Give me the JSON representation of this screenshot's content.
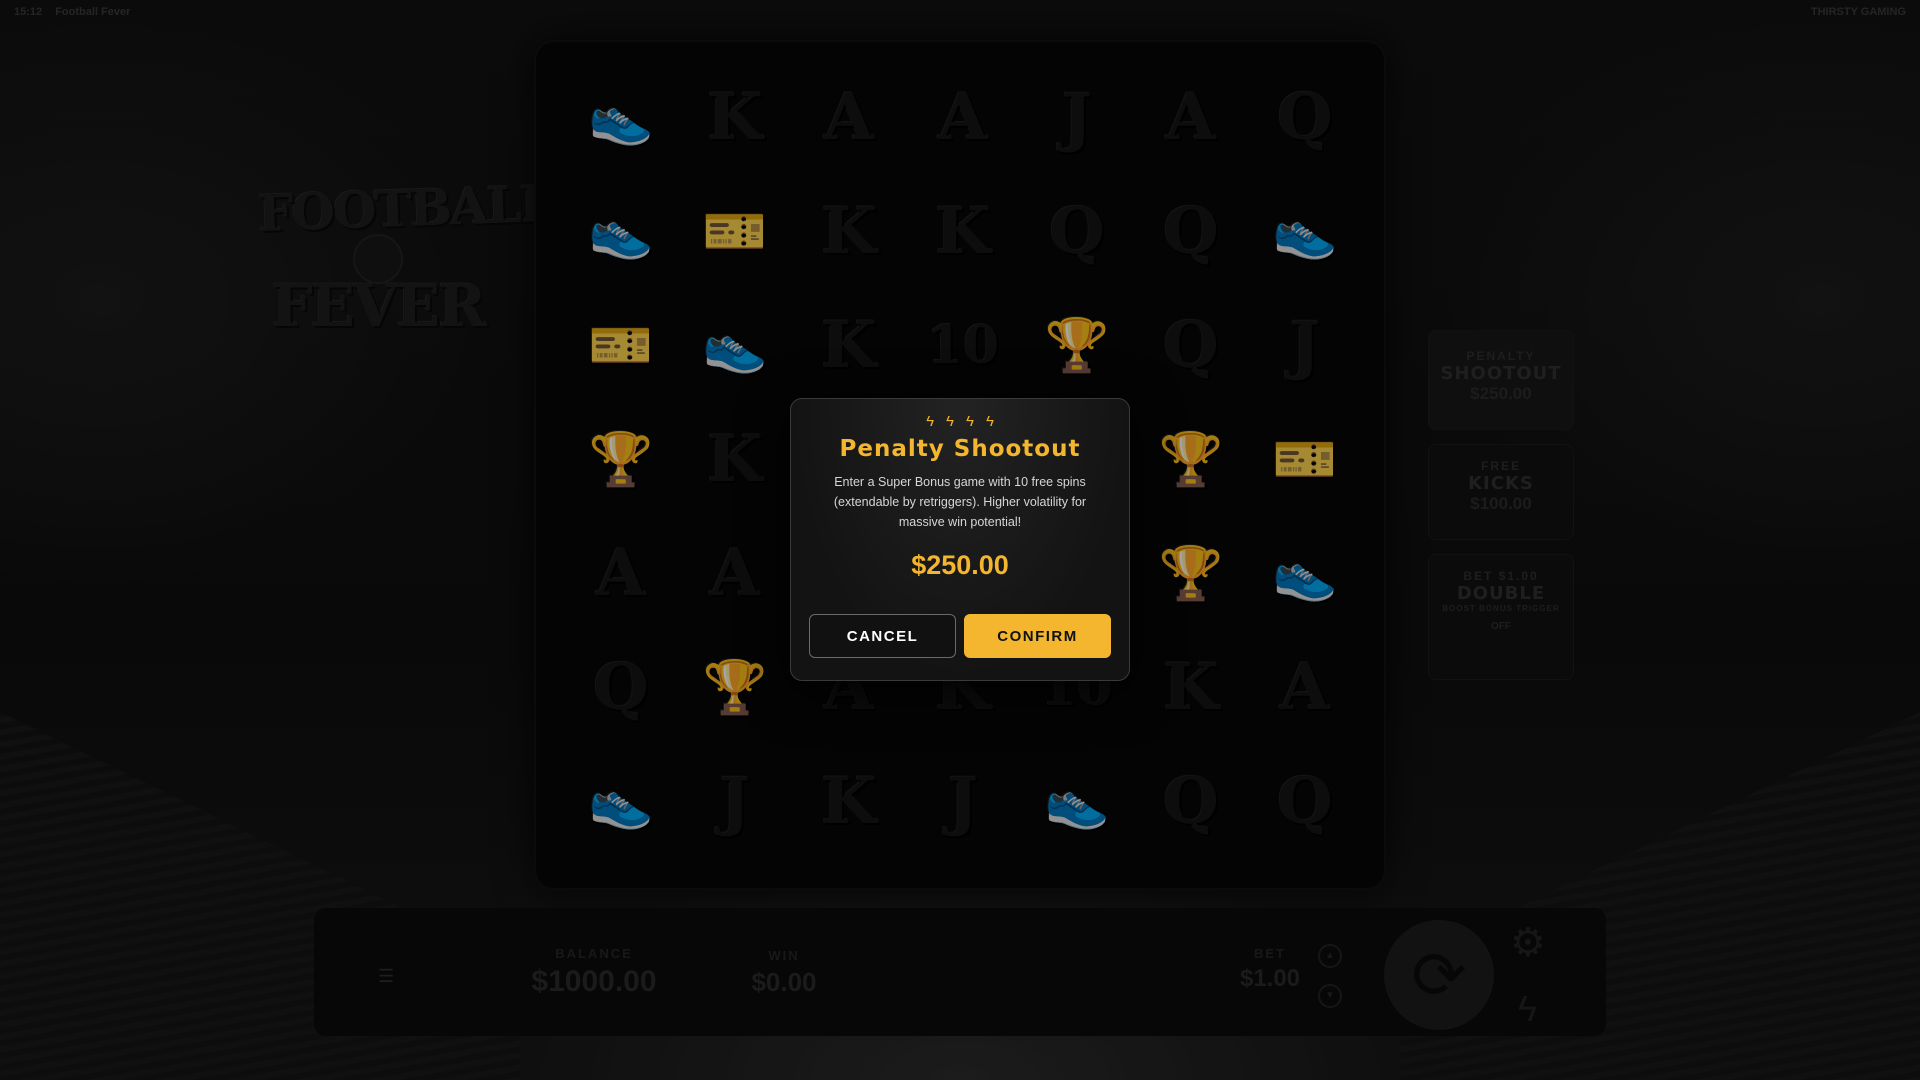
{
  "topbar": {
    "time": "15:12",
    "title": "Football Fever",
    "brand": "THIRSTY GAMING"
  },
  "logo": {
    "line1": "FOOTBALL",
    "line2": "FEVER"
  },
  "reels": [
    [
      "👟",
      "K",
      "A",
      "A",
      "J",
      "A",
      "Q"
    ],
    [
      "👟",
      "🎫",
      "K",
      "K",
      "Q",
      "Q",
      "👟"
    ],
    [
      "🎫",
      "👟",
      "K",
      "10",
      "🏆",
      "Q",
      "J"
    ],
    [
      "🏆",
      "K",
      "",
      "",
      "",
      "🏆",
      "🎫"
    ],
    [
      "A",
      "A",
      "",
      "",
      "",
      "🏆",
      "👟"
    ],
    [
      "Q",
      "🏆",
      "A",
      "K",
      "10",
      "K",
      "A"
    ],
    [
      "👟",
      "J",
      "K",
      "J",
      "👟",
      "Q",
      "Q"
    ]
  ],
  "side_buttons": {
    "penalty": {
      "small": "PENALTY",
      "big": "SHOOTOUT",
      "price": "$250.00"
    },
    "free_kicks": {
      "small": "FREE",
      "big": "KICKS",
      "price": "$100.00"
    },
    "double": {
      "small": "BET $1.00",
      "big": "DOUBLE",
      "tiny": "BOOST BONUS TRIGGER",
      "toggle": "OFF"
    }
  },
  "bottom": {
    "menu_icon": "menu-icon",
    "balance_label": "BALANCE",
    "balance_value": "$1000.00",
    "win_label": "WIN",
    "win_value": "$0.00",
    "bet_label": "BET",
    "bet_value": "$1.00"
  },
  "modal": {
    "title": "Penalty Shootout",
    "description": "Enter a Super Bonus game with 10 free spins (extendable by retriggers). Higher volatility for massive win potential!",
    "price": "$250.00",
    "cancel_label": "CANCEL",
    "confirm_label": "CONFIRM"
  },
  "colors": {
    "accent": "#f3b62e",
    "modal_bg": "#131313"
  }
}
